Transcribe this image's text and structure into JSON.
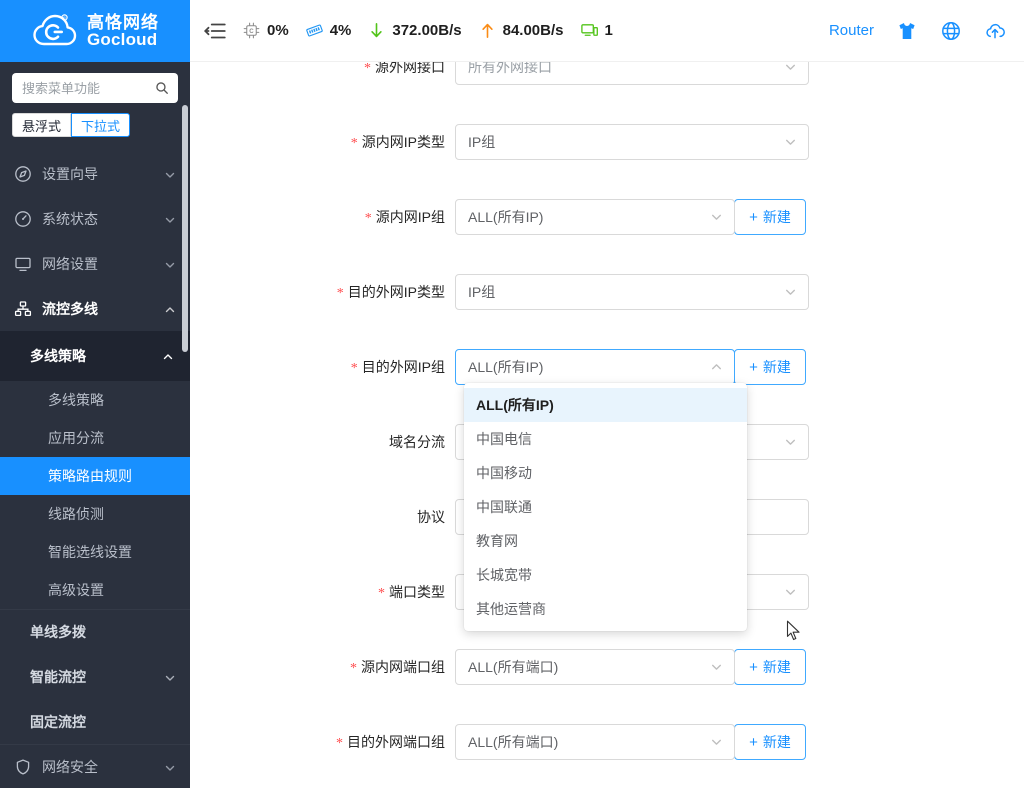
{
  "brand": {
    "name_cn": "高恪网络",
    "name_en": "Gocloud",
    "logo_icon": "cloud-logo-icon"
  },
  "sidebar": {
    "search": {
      "placeholder": "搜索菜单功能",
      "value": "",
      "icon": "search-icon"
    },
    "segments": [
      {
        "label": "悬浮式",
        "active": false
      },
      {
        "label": "下拉式",
        "active": true
      }
    ],
    "items": [
      {
        "label": "设置向导",
        "icon": "compass-icon",
        "arrow": "chevron-down-icon"
      },
      {
        "label": "系统状态",
        "icon": "gauge-icon",
        "arrow": "chevron-down-icon"
      },
      {
        "label": "网络设置",
        "icon": "monitor-icon",
        "arrow": "chevron-down-icon"
      },
      {
        "label": "流控多线",
        "icon": "sitemap-icon",
        "arrow": "chevron-up-icon"
      }
    ],
    "submenu": {
      "head": {
        "label": "多线策略",
        "arrow": "chevron-up-icon"
      },
      "leaves": [
        {
          "label": "多线策略",
          "selected": false
        },
        {
          "label": "应用分流",
          "selected": false
        },
        {
          "label": "策略路由规则",
          "selected": true
        },
        {
          "label": "线路侦测",
          "selected": false
        },
        {
          "label": "智能选线设置",
          "selected": false
        },
        {
          "label": "高级设置",
          "selected": false
        }
      ]
    },
    "groups": [
      {
        "label": "单线多拨",
        "arrow": ""
      },
      {
        "label": "智能流控",
        "arrow": "chevron-down-icon"
      },
      {
        "label": "固定流控",
        "arrow": ""
      }
    ],
    "bottom_item": {
      "label": "网络安全",
      "icon": "shield-icon",
      "arrow": "chevron-down-icon"
    }
  },
  "header": {
    "collapse_icon": "menu-collapse-icon",
    "stats": [
      {
        "icon": "cpu-icon",
        "value": "0%"
      },
      {
        "icon": "ram-icon",
        "value": "4%"
      },
      {
        "icon": "arrow-down-icon",
        "value": "372.00B/s"
      },
      {
        "icon": "arrow-up-icon",
        "value": "84.00B/s"
      },
      {
        "icon": "device-icon",
        "value": "1"
      }
    ],
    "router_label": "Router",
    "icons": [
      {
        "name": "theme-shirt-icon"
      },
      {
        "name": "language-globe-icon"
      },
      {
        "name": "cloud-upload-icon"
      }
    ]
  },
  "form": {
    "rows": [
      {
        "label": "源外网接口",
        "required": true,
        "control": "select",
        "value": "所有外网接口",
        "muted": true,
        "chevron": "chevron-down-icon",
        "new_button": false,
        "cutoff": true
      },
      {
        "label": "源内网IP类型",
        "required": true,
        "control": "select",
        "value": "IP组",
        "muted": false,
        "chevron": "chevron-down-icon",
        "new_button": false
      },
      {
        "label": "源内网IP组",
        "required": true,
        "control": "select",
        "value": "ALL(所有IP)",
        "muted": false,
        "chevron": "chevron-down-icon",
        "new_button": true
      },
      {
        "label": "目的外网IP类型",
        "required": true,
        "control": "select",
        "value": "IP组",
        "muted": false,
        "chevron": "chevron-down-icon",
        "new_button": false
      },
      {
        "label": "目的外网IP组",
        "required": true,
        "control": "select",
        "value": "ALL(所有IP)",
        "muted": false,
        "chevron": "chevron-up-icon",
        "new_button": true,
        "open": true
      },
      {
        "label": "域名分流",
        "required": false,
        "control": "select",
        "value": "",
        "muted": false,
        "chevron": "chevron-down-icon",
        "new_button": false
      },
      {
        "label": "协议",
        "required": false,
        "control": "input",
        "value": "",
        "muted": false,
        "chevron": "",
        "new_button": false
      },
      {
        "label": "端口类型",
        "required": true,
        "control": "select",
        "value": "",
        "muted": false,
        "chevron": "chevron-down-icon",
        "new_button": false
      },
      {
        "label": "源内网端口组",
        "required": true,
        "control": "select",
        "value": "ALL(所有端口)",
        "muted": false,
        "chevron": "chevron-down-icon",
        "new_button": true
      },
      {
        "label": "目的外网端口组",
        "required": true,
        "control": "select",
        "value": "ALL(所有端口)",
        "muted": false,
        "chevron": "chevron-down-icon",
        "new_button": true
      }
    ],
    "new_button_label": "新建",
    "new_button_plus": "+"
  },
  "dropdown": {
    "options": [
      {
        "label": "ALL(所有IP)",
        "selected": true
      },
      {
        "label": "中国电信",
        "selected": false
      },
      {
        "label": "中国移动",
        "selected": false
      },
      {
        "label": "中国联通",
        "selected": false
      },
      {
        "label": "教育网",
        "selected": false
      },
      {
        "label": "长城宽带",
        "selected": false
      },
      {
        "label": "其他运营商",
        "selected": false
      }
    ]
  },
  "colors": {
    "brand_blue": "#1890ff",
    "sidebar_bg": "#2b313e",
    "sidebar_dark": "#1f2430",
    "required_red": "#ff4d4f",
    "dropdown_selected_bg": "#e8f4fd",
    "download_green": "#52c41a",
    "upload_orange": "#fa8c16"
  }
}
